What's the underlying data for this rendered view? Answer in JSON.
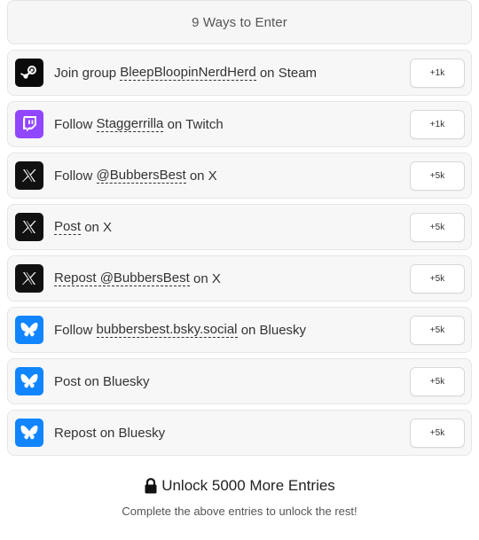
{
  "header": {
    "title": "9 Ways to Enter"
  },
  "entries": [
    {
      "icon": "steam-icon",
      "icon_bg": "#0b0b0b",
      "pre": "Join group",
      "link": "BleepBloopinNerdHerd",
      "post": "on Steam",
      "points": "+1k"
    },
    {
      "icon": "twitch-icon",
      "icon_bg": "#9146ff",
      "pre": "Follow",
      "link": "Staggerrilla",
      "post": "on Twitch",
      "points": "+1k"
    },
    {
      "icon": "x-icon",
      "icon_bg": "#111111",
      "pre": "Follow",
      "link": "@BubbersBest",
      "post": "on X",
      "points": "+5k"
    },
    {
      "icon": "x-icon",
      "icon_bg": "#111111",
      "pre": "",
      "link": "Post",
      "post": "on X",
      "points": "+5k"
    },
    {
      "icon": "x-icon",
      "icon_bg": "#111111",
      "pre": "",
      "link": "Repost @BubbersBest",
      "post": "on X",
      "points": "+5k"
    },
    {
      "icon": "bluesky-icon",
      "icon_bg": "#1185fe",
      "pre": "Follow",
      "link": "bubbersbest.bsky.social",
      "post": "on Bluesky",
      "points": "+5k"
    },
    {
      "icon": "bluesky-icon",
      "icon_bg": "#1185fe",
      "pre": "Post on Bluesky",
      "link": "",
      "post": "",
      "points": "+5k"
    },
    {
      "icon": "bluesky-icon",
      "icon_bg": "#1185fe",
      "pre": "Repost on Bluesky",
      "link": "",
      "post": "",
      "points": "+5k"
    }
  ],
  "unlock": {
    "icon": "lock-icon",
    "title": "Unlock 5000 More Entries",
    "subtitle": "Complete the above entries to unlock the rest!"
  }
}
